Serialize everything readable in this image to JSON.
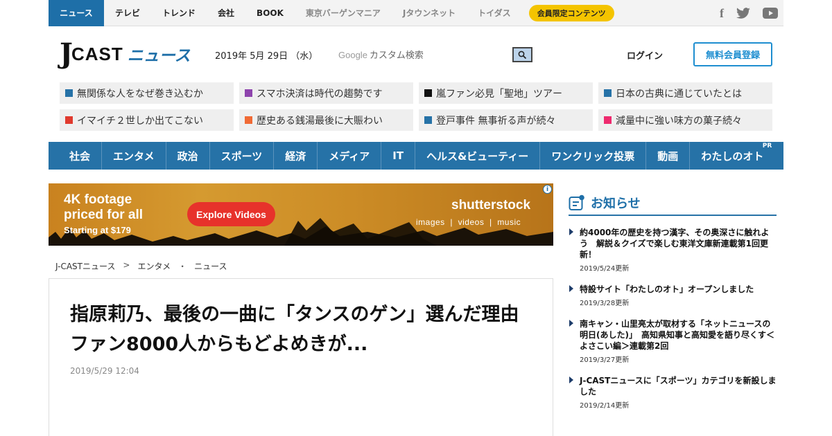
{
  "topbar": {
    "nav": [
      {
        "label": "ニュース",
        "active": true
      },
      {
        "label": "テレビ",
        "active": false
      },
      {
        "label": "トレンド",
        "active": false
      },
      {
        "label": "会社",
        "active": false
      },
      {
        "label": "BOOK",
        "active": false
      }
    ],
    "external": [
      "東京バーゲンマニア",
      "Jタウンネット",
      "トイダス"
    ],
    "member_label": "会員限定コンテンツ",
    "social_icons": [
      "facebook-icon",
      "twitter-icon",
      "youtube-icon"
    ],
    "social_glyphs": [
      "f",
      "t"
    ]
  },
  "header": {
    "logo": {
      "j": "J",
      "cast": "CAST",
      "news": "ニュース"
    },
    "date": "2019年 5月 29日 （水）",
    "search": {
      "google": "Google",
      "placeholder": "カスタム検索"
    },
    "login": "ログイン",
    "register": "無料会員登録"
  },
  "topics": [
    {
      "label": "無関係な人をなぜ巻き込むか",
      "color": "#2672a7"
    },
    {
      "label": "スマホ決済は時代の趨勢です",
      "color": "#8e44ad"
    },
    {
      "label": "嵐ファン必見「聖地」ツアー",
      "color": "#111111"
    },
    {
      "label": "日本の古典に通じていたとは",
      "color": "#2672a7"
    },
    {
      "label": "イマイチ２世しか出てこない",
      "color": "#e03a2e"
    },
    {
      "label": "歴史ある銭湯最後に大賑わい",
      "color": "#f06a35"
    },
    {
      "label": "登戸事件 無事祈る声が続々",
      "color": "#2672a7"
    },
    {
      "label": "減量中に強い味方の菓子続々",
      "color": "#ee2a6e"
    }
  ],
  "categories": [
    "社会",
    "エンタメ",
    "政治",
    "スポーツ",
    "経済",
    "メディア",
    "IT",
    "ヘルス&ビューティー",
    "ワンクリック投票",
    "動画",
    "わたしのオト"
  ],
  "pr_label": "PR",
  "ad": {
    "headline_1": "4K footage",
    "headline_2": "priced for all",
    "price": "Starting at $179",
    "cta": "Explore Videos",
    "brand": "shutterstock",
    "sub": "images  |  videos  |  music",
    "info": "i"
  },
  "breadcrumb": [
    "J-CASTニュース",
    "エンタメ",
    "ニュース"
  ],
  "breadcrumb_seps": [
    ">",
    "・"
  ],
  "article": {
    "title": "指原莉乃、最後の一曲に「タンスのゲン」選んだ理由　ファン8000人からもどよめきが...",
    "timestamp": "2019/5/29 12:04"
  },
  "sidebar": {
    "title": "お知らせ",
    "items": [
      {
        "text": "約4000年の歴史を持つ漢字、その奥深さに触れよう　解説＆クイズで楽しむ東洋文庫新連載第1回更新！",
        "date": "2019/5/24更新"
      },
      {
        "text": "特設サイト「わたしのオト」オープンしました",
        "date": "2019/3/28更新"
      },
      {
        "text": "南キャン・山里亮太が取材する「ネットニュースの明日(あした)」　高知県知事と高知愛を語り尽くす＜よさこい編＞連載第2回",
        "date": "2019/3/27更新"
      },
      {
        "text": "J-CASTニュースに「スポーツ」カテゴリを新設しました",
        "date": "2019/2/14更新"
      }
    ]
  }
}
